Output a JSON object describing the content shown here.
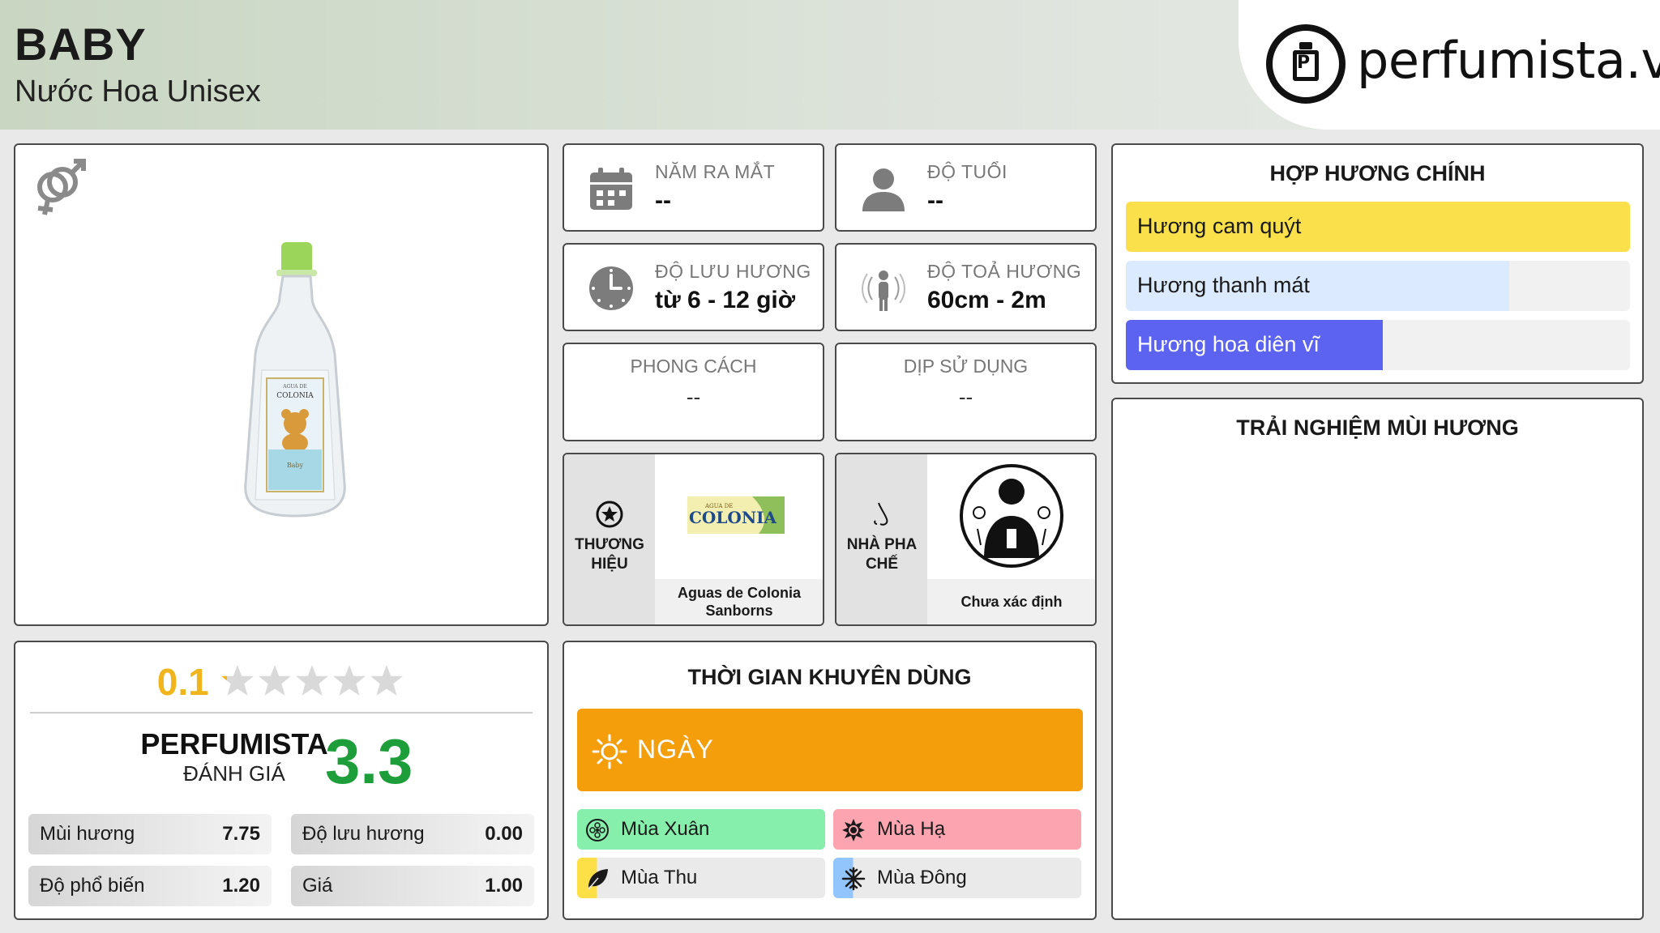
{
  "header": {
    "title": "BABY",
    "subtitle": "Nước Hoa Unisex",
    "logo_text": "perfumista.vn"
  },
  "product": {
    "gender_icon": "male-female-icon",
    "bottle_label_brand": "COLONIA",
    "bottle_label_name": "Baby"
  },
  "rating": {
    "user_score": "0.1",
    "star_count": 5,
    "star_fill_fraction": 0.02,
    "perfumista_label": "PERFUMISTA",
    "perfumista_sub": "ĐÁNH GIÁ",
    "perfumista_score": "3.3",
    "metrics": [
      {
        "label": "Mùi hương",
        "value": "7.75"
      },
      {
        "label": "Độ lưu hương",
        "value": "0.00"
      },
      {
        "label": "Độ phổ biến",
        "value": "1.20"
      },
      {
        "label": "Giá",
        "value": "1.00"
      }
    ]
  },
  "info": {
    "launch": {
      "label": "NĂM RA MẮT",
      "value": "--",
      "icon": "calendar-icon"
    },
    "age": {
      "label": "ĐỘ TUỔI",
      "value": "--",
      "icon": "person-icon"
    },
    "longevity": {
      "label": "ĐỘ LƯU HƯƠNG",
      "value": "từ 6 - 12 giờ",
      "icon": "clock-icon"
    },
    "sillage": {
      "label": "ĐỘ TOẢ HƯƠNG",
      "value": "60cm - 2m",
      "icon": "radiating-person-icon"
    },
    "style": {
      "label": "PHONG CÁCH",
      "value": "--"
    },
    "occasion": {
      "label": "DỊP SỬ DỤNG",
      "value": "--"
    },
    "brand": {
      "label_line1": "THƯƠNG",
      "label_line2": "HIỆU",
      "logo_text": "COLONIA",
      "logo_small": "AGUA DE",
      "name_line1": "Aguas de Colonia",
      "name_line2": "Sanborns"
    },
    "perfumer": {
      "label_line1": "NHÀ PHA",
      "label_line2": "CHẾ",
      "name": "Chưa xác định"
    }
  },
  "recommended": {
    "title": "THỜI GIAN KHUYÊN DÙNG",
    "day_label": "NGÀY",
    "seasons": [
      {
        "label": "Mùa Xuân",
        "icon": "flower-icon",
        "fill": 1.0,
        "color": "#86efac"
      },
      {
        "label": "Mùa Hạ",
        "icon": "sun-icon",
        "fill": 1.0,
        "color": "#fca5b1"
      },
      {
        "label": "Mùa Thu",
        "icon": "leaf-icon",
        "fill": 0.08,
        "color": "#fde047"
      },
      {
        "label": "Mùa Đông",
        "icon": "snowflake-icon",
        "fill": 0.08,
        "color": "#93c5fd"
      }
    ]
  },
  "accords": {
    "title": "HỢP HƯƠNG CHÍNH",
    "items": [
      {
        "label": "Hương cam quýt",
        "fill": 1.0,
        "color": "#fae04a",
        "text_color": "#1a1a1a"
      },
      {
        "label": "Hương thanh mát",
        "fill": 0.76,
        "color": "#dbeafe",
        "text_color": "#1a1a1a"
      },
      {
        "label": "Hương hoa diên vĩ",
        "fill": 0.51,
        "color": "#5b63f0",
        "text_color": "#ffffff"
      }
    ]
  },
  "experience": {
    "title": "TRẢI NGHIỆM MÙI HƯƠNG"
  }
}
